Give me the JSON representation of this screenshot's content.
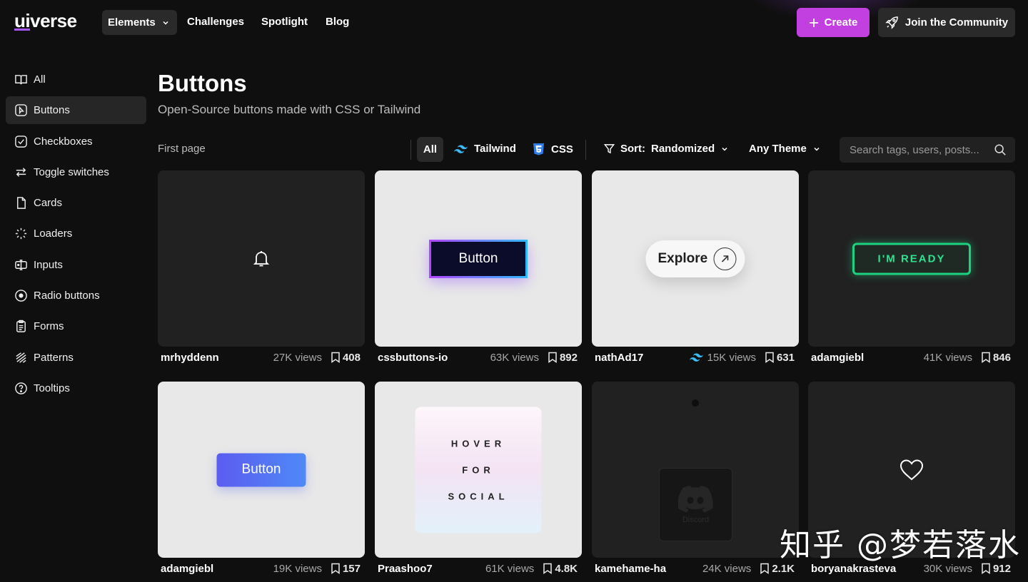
{
  "header": {
    "logo": "uiverse",
    "nav_elements": "Elements",
    "nav_links": [
      "Challenges",
      "Spotlight",
      "Blog"
    ],
    "create_label": "Create",
    "community_label": "Join the Community",
    "accent": "#c23fe0"
  },
  "sidebar": {
    "items": [
      {
        "label": "All",
        "icon": "book-icon"
      },
      {
        "label": "Buttons",
        "icon": "button-icon",
        "active": true
      },
      {
        "label": "Checkboxes",
        "icon": "checkbox-icon"
      },
      {
        "label": "Toggle switches",
        "icon": "toggle-icon"
      },
      {
        "label": "Cards",
        "icon": "card-icon"
      },
      {
        "label": "Loaders",
        "icon": "loader-icon"
      },
      {
        "label": "Inputs",
        "icon": "input-icon"
      },
      {
        "label": "Radio buttons",
        "icon": "radio-icon"
      },
      {
        "label": "Forms",
        "icon": "form-icon"
      },
      {
        "label": "Patterns",
        "icon": "pattern-icon"
      },
      {
        "label": "Tooltips",
        "icon": "tooltip-icon"
      }
    ]
  },
  "main": {
    "title": "Buttons",
    "subtitle": "Open-Source buttons made with CSS or Tailwind",
    "pager": "First page",
    "filters": {
      "all": "All",
      "tailwind": "Tailwind",
      "css": "CSS"
    },
    "sort_label": "Sort:",
    "sort_value": "Randomized",
    "theme": "Any Theme",
    "search_placeholder": "Search tags, users, posts..."
  },
  "cards": [
    {
      "author": "mrhyddenn",
      "views": "27K views",
      "saves": "408",
      "preview": {}
    },
    {
      "author": "cssbuttons-io",
      "views": "63K views",
      "saves": "892",
      "preview": {
        "text": "Button"
      }
    },
    {
      "author": "nathAd17",
      "views": "15K views",
      "saves": "631",
      "tailwind": true,
      "preview": {
        "text": "Explore"
      }
    },
    {
      "author": "adamgiebl",
      "views": "41K views",
      "saves": "846",
      "preview": {
        "text": "I'M READY"
      }
    },
    {
      "author": "adamgiebl",
      "views": "19K views",
      "saves": "157",
      "preview": {
        "text": "Button"
      }
    },
    {
      "author": "Praashoo7",
      "views": "61K views",
      "saves": "4.8K",
      "preview": {
        "lines": [
          "HOVER",
          "FOR",
          "SOCIAL"
        ]
      }
    },
    {
      "author": "kamehame-ha",
      "views": "24K views",
      "saves": "2.1K",
      "preview": {
        "text": "Discord"
      }
    },
    {
      "author": "boryanakrasteva",
      "views": "30K views",
      "saves": "912",
      "preview": {}
    }
  ],
  "watermark": "知乎 @梦若落水"
}
